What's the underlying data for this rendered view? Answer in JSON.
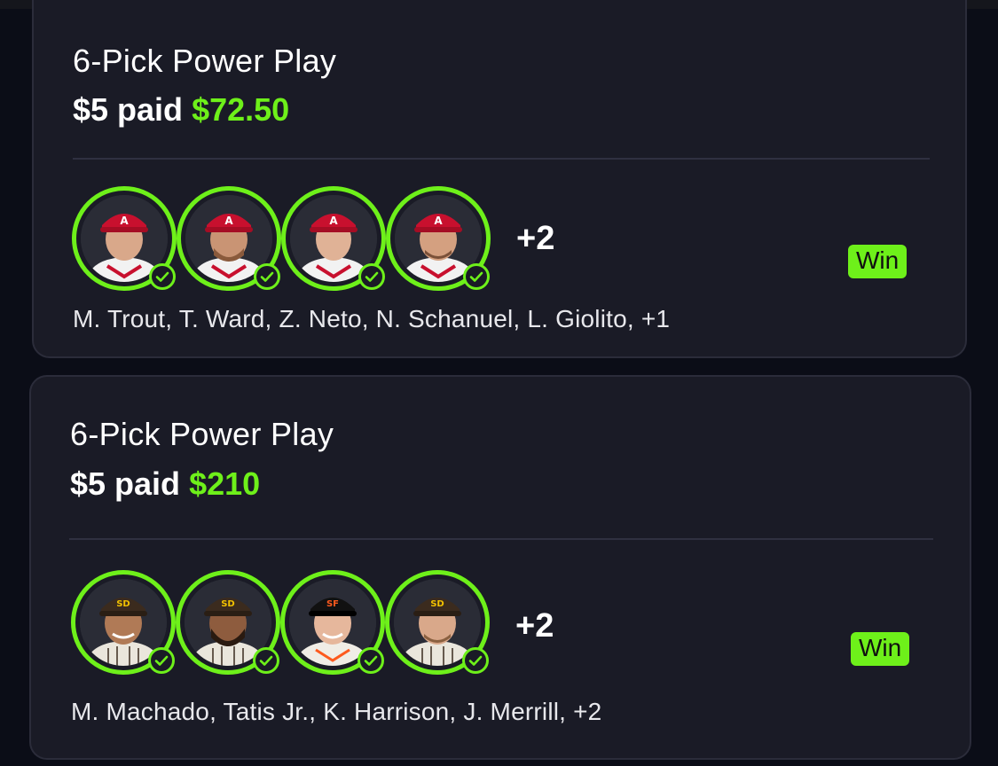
{
  "entries": [
    {
      "title": "6-Pick Power Play",
      "paid_label": "$5 paid",
      "payout": "$72.50",
      "extra_count": "+2",
      "result": "Win",
      "players_summary": "M. Trout, T. Ward, Z. Neto, N. Schanuel, L. Giolito, +1",
      "avatars": [
        {
          "team": "angels",
          "cap_color": "#c8102e",
          "jersey_color": "#f2f2f2",
          "status": "check-icon"
        },
        {
          "team": "angels",
          "cap_color": "#c8102e",
          "jersey_color": "#f2f2f2",
          "status": "check-icon"
        },
        {
          "team": "angels",
          "cap_color": "#c8102e",
          "jersey_color": "#f2f2f2",
          "status": "check-icon"
        },
        {
          "team": "angels",
          "cap_color": "#c8102e",
          "jersey_color": "#f2f2f2",
          "status": "check-icon"
        }
      ]
    },
    {
      "title": "6-Pick Power Play",
      "paid_label": "$5 paid",
      "payout": "$210",
      "extra_count": "+2",
      "result": "Win",
      "players_summary": "M. Machado, Tatis Jr., K. Harrison, J. Merrill, +2",
      "avatars": [
        {
          "team": "padres",
          "cap_color": "#3b2b1e",
          "jersey_color": "#eae6dc",
          "status": "check-icon"
        },
        {
          "team": "padres",
          "cap_color": "#3b2b1e",
          "jersey_color": "#eae6dc",
          "status": "check-icon"
        },
        {
          "team": "giants",
          "cap_color": "#111111",
          "jersey_color": "#f0ede6",
          "status": "check-icon"
        },
        {
          "team": "padres",
          "cap_color": "#3b2b1e",
          "jersey_color": "#eae6dc",
          "status": "check-icon"
        }
      ]
    }
  ],
  "colors": {
    "accent_green": "#6ef01a",
    "background": "#0b0d17",
    "card": "#1a1b26"
  }
}
